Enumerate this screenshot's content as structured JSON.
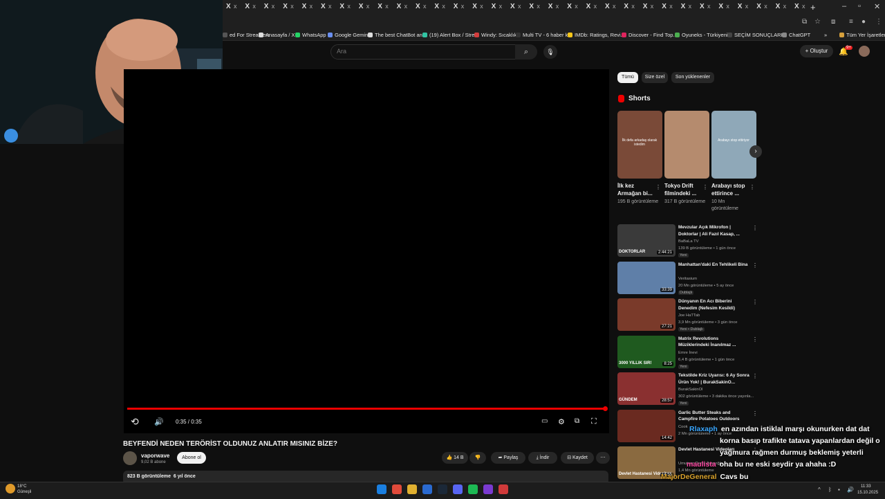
{
  "browser": {
    "tab_icon": "X",
    "tab_close": "x",
    "new_tab": "+",
    "bookmarks": [
      {
        "label": "ed For Streamers",
        "color": "#555555"
      },
      {
        "label": "Anasayfa / X",
        "color": "#dddddd"
      },
      {
        "label": "WhatsApp",
        "color": "#25d366"
      },
      {
        "label": "Google Gemini",
        "color": "#6a8ff0"
      },
      {
        "label": "The best ChatBot an...",
        "color": "#dddddd"
      },
      {
        "label": "(19) Alert Box / Stre...",
        "color": "#31c3a2"
      },
      {
        "label": "Windy: Sıcaklık",
        "color": "#d43d3d"
      },
      {
        "label": "Multi TV - 6 haber k...",
        "color": "#333333"
      },
      {
        "label": "IMDb: Ratings, Revi...",
        "color": "#f5c518"
      },
      {
        "label": "Discover - Find Top...",
        "color": "#e0245e"
      },
      {
        "label": "Oyuneks - Türkiyeni...",
        "color": "#4caf50"
      },
      {
        "label": "SEÇİM SONUÇLARI...",
        "color": "#444444"
      },
      {
        "label": "ChatGPT",
        "color": "#888888"
      }
    ],
    "more_bookmarks": "»",
    "all_bookmarks": "Tüm Yer İşaretleri"
  },
  "header": {
    "search_placeholder": "Ara",
    "create_label": "Oluştur",
    "notification_count": "9+"
  },
  "player": {
    "time": "0:35 / 0:35",
    "progress_fraction": 1.0,
    "accent": "#ff0000"
  },
  "video": {
    "title": "BEYFENDİ NEDEN TERÖRİST OLDUNUZ ANLATIR MISINIZ BİZE?",
    "channel": "vaporwave",
    "subscribers": "9,02 B abone",
    "subscribe_label": "Abone ol",
    "like_count": "14 B",
    "share_label": "Paylaş",
    "download_label": "İndir",
    "save_label": "Kaydet",
    "views": "823 B görüntüleme",
    "age": "6 yıl önce"
  },
  "filters": [
    "Tümü",
    "Size özel",
    "Son yüklenenler"
  ],
  "shorts": {
    "title": "Shorts",
    "items": [
      {
        "title": "İlk kez Armağan bi...",
        "views": "195 B görüntüleme",
        "color": "#7a4a38",
        "overlay": "İlk defa arkadaş olarak istedim"
      },
      {
        "title": "Tokyo Drift filmindeki ...",
        "views": "317 B görüntüleme",
        "color": "#b58b6e",
        "overlay": ""
      },
      {
        "title": "Arabayı stop ettirince ...",
        "views": "10 Mn görüntüleme",
        "color": "#8fa8b8",
        "overlay": "Arabayı stop ettiriyor"
      }
    ]
  },
  "recommendations": [
    {
      "title": "Mevzular Açık Mikrofon | Doktorlar | Ali Fazıl Kasap, ...",
      "channel": "BaBaLa TV",
      "meta": "139 B görüntüleme • 1 gün önce",
      "badge": "Yeni",
      "duration": "2:44:21",
      "color": "#3a3a3a",
      "overlay": "DOKTORLAR"
    },
    {
      "title": "Manhattan'daki En Tehlikeli Bina",
      "channel": "Veritasium",
      "meta": "20 Mn görüntüleme • 5 ay önce",
      "badge": "Dublajlı",
      "duration": "33:39",
      "color": "#5f7fa8",
      "overlay": ""
    },
    {
      "title": "Dünyanın En Acı Biberini Denedim (Nefesim Kesildi)",
      "channel": "Joe HaTTab",
      "meta": "3,9 Mn görüntüleme • 3 gün önce",
      "badge": "Yeni • Dublajlı",
      "duration": "27:21",
      "color": "#7a3a2a",
      "overlay": ""
    },
    {
      "title": "Matrix Revolutions Müziklerindeki İnanılmaz ...",
      "channel": "Emre İnevi",
      "meta": "6,4 B görüntüleme • 1 gün önce",
      "badge": "Yeni",
      "duration": "8:25",
      "color": "#1f5a1f",
      "overlay": "3000 YILLIK SIR!"
    },
    {
      "title": "Tekstilde Kriz Uyarısı: 6 Ay Sonra Ürün Yok! | BurakSakinO...",
      "channel": "BurakSakinOl",
      "meta": "302 görüntüleme • 3 dakika önce yayınla...",
      "badge": "Yeni",
      "duration": "28:57",
      "color": "#8a3030",
      "overlay": "GÜNDEM"
    },
    {
      "title": "Garlic Butter Steaks and Campfire Potatoes Outdoors",
      "channel": "Cook",
      "meta": "2 Mn görüntüleme • 1 ay önce",
      "badge": "",
      "duration": "14:42",
      "color": "#6a2a20",
      "overlay": ""
    },
    {
      "title": "Devlet Hastanesi Videoları",
      "channel": "Umutcan Deniz İlyasoğlu",
      "meta": "1,4 Mn görüntüleme",
      "badge": "",
      "duration": "14:55",
      "color": "#8a6a40",
      "overlay": "Devlet Hastanesi Videoları"
    }
  ],
  "chat": [
    {
      "name": "Rlaxaph",
      "name_color": "#3aa7ff",
      "text": "en azından istiklal marşı okunurken dat dat"
    },
    {
      "name": "",
      "name_color": "#ffffff",
      "text": "korna basıp trafikte tatava yapanlardan değil o"
    },
    {
      "name": "",
      "name_color": "#ffffff",
      "text": "yağmura rağmen durmuş beklemiş yeterli"
    },
    {
      "name": "maulista",
      "name_color": "#ff4aa5",
      "text": "oha bu ne eski seydir ya ahaha :D"
    },
    {
      "name": "MajorDeGeneral",
      "name_color": "#d8a02a",
      "text": "Cavs bu"
    },
    {
      "name": "MajorDeGeneral",
      "name_color": "#d8a02a",
      "text": "🤮"
    }
  ],
  "taskbar": {
    "temperature": "18°C",
    "weather": "Güneşli",
    "time": "11:33",
    "date": "15.10.2025"
  }
}
